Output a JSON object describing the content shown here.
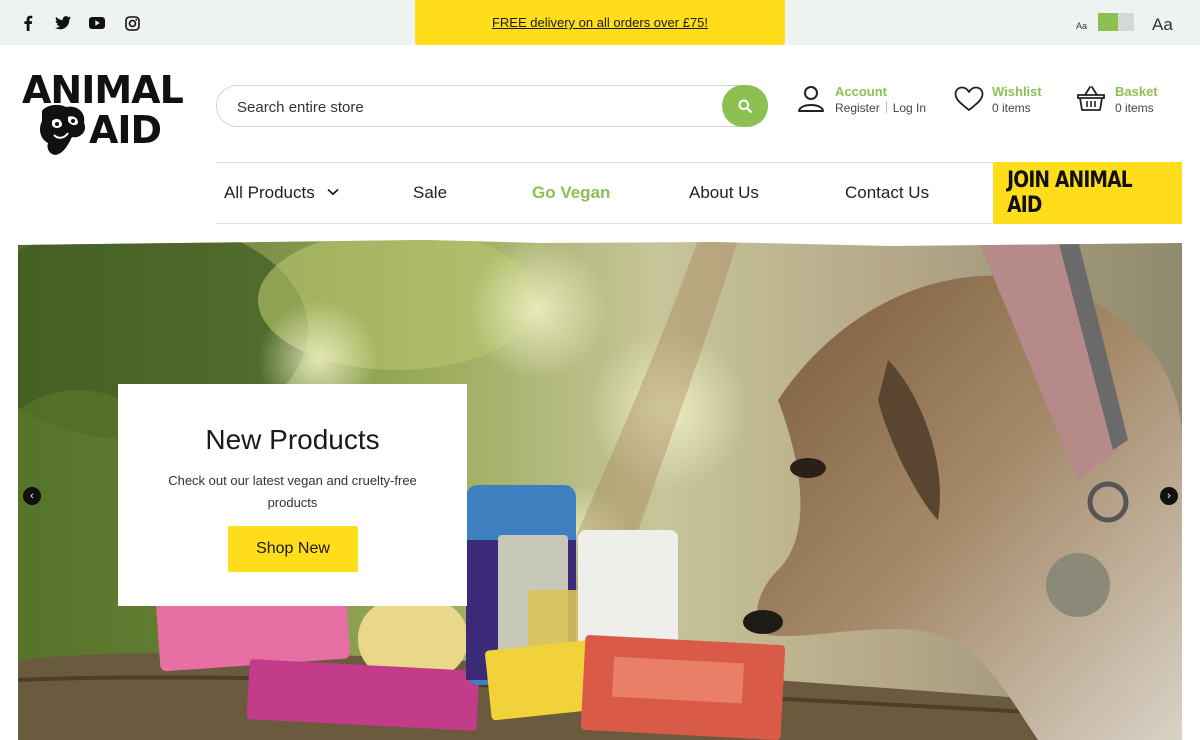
{
  "topbar": {
    "social": [
      {
        "name": "facebook-icon"
      },
      {
        "name": "twitter-icon"
      },
      {
        "name": "youtube-icon"
      },
      {
        "name": "instagram-icon"
      }
    ],
    "promo_text": "FREE delivery on all orders over £75!",
    "font_size_small": "Aa",
    "font_size_large": "Aa"
  },
  "logo": {
    "line1": "ANIMAL",
    "line2": "AID"
  },
  "search": {
    "placeholder": "Search entire store"
  },
  "header": {
    "account": {
      "title": "Account",
      "register": "Register",
      "login": "Log In"
    },
    "wishlist": {
      "title": "Wishlist",
      "count": "0 items"
    },
    "basket": {
      "title": "Basket",
      "count": "0 items"
    }
  },
  "nav": {
    "all_products": "All Products",
    "sale": "Sale",
    "go_vegan": "Go Vegan",
    "about": "About Us",
    "contact": "Contact Us",
    "join": "JOIN ANIMAL AID"
  },
  "hero": {
    "title": "New Products",
    "text": "Check out our latest vegan and cruelty-free products",
    "button": "Shop New",
    "prev": "‹",
    "next": "›"
  },
  "colors": {
    "accent_green": "#8cc152",
    "accent_yellow": "#ffdd1a",
    "topbar_bg": "#eef3f1"
  }
}
